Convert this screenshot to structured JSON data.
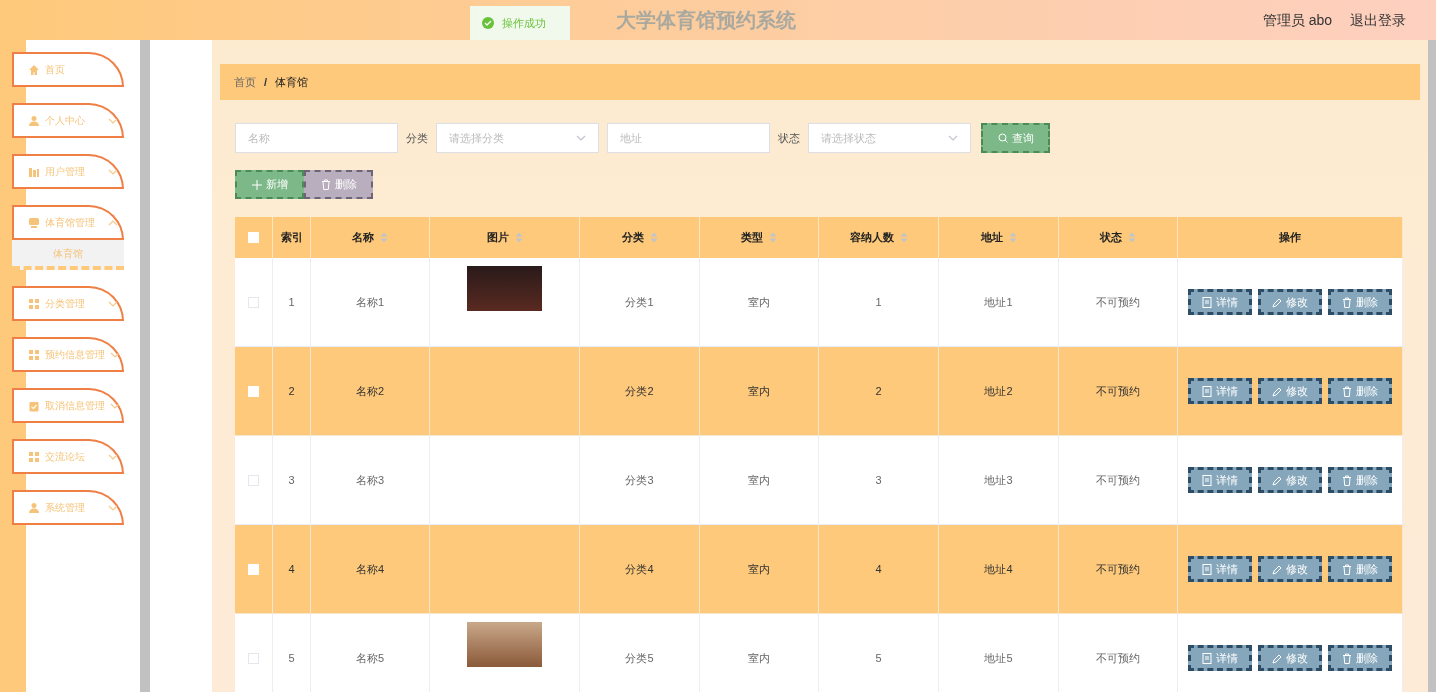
{
  "header": {
    "title": "大学体育馆预约系统",
    "user": "管理员 abo",
    "logout": "退出登录"
  },
  "toast": {
    "text": "操作成功"
  },
  "sidebar": {
    "items": [
      {
        "label": "首页",
        "expandable": false
      },
      {
        "label": "个人中心",
        "expandable": true,
        "expanded": false
      },
      {
        "label": "用户管理",
        "expandable": true,
        "expanded": false
      },
      {
        "label": "体育馆管理",
        "expandable": true,
        "expanded": true,
        "children": [
          {
            "label": "体育馆",
            "selected": true
          }
        ]
      },
      {
        "label": "分类管理",
        "expandable": true,
        "expanded": false
      },
      {
        "label": "预约信息管理",
        "expandable": true,
        "expanded": false
      },
      {
        "label": "取消信息管理",
        "expandable": true,
        "expanded": false
      },
      {
        "label": "交流论坛",
        "expandable": true,
        "expanded": false
      },
      {
        "label": "系统管理",
        "expandable": true,
        "expanded": false
      }
    ]
  },
  "breadcrumb": {
    "items": [
      "首页",
      "体育馆"
    ],
    "separator": "/"
  },
  "filters": {
    "name": {
      "placeholder": "名称"
    },
    "category": {
      "label": "分类",
      "placeholder": "请选择分类"
    },
    "address": {
      "placeholder": "地址"
    },
    "status": {
      "label": "状态",
      "placeholder": "请选择状态"
    },
    "search_button": "查询"
  },
  "actions": {
    "add": "新增",
    "delete": "删除"
  },
  "table": {
    "select_all_checked": false,
    "columns": [
      {
        "kind": "checkbox"
      },
      {
        "label": "索引",
        "kind": "text",
        "sortable": false
      },
      {
        "label": "名称",
        "kind": "text",
        "sortable": true
      },
      {
        "label": "图片",
        "kind": "image",
        "sortable": true
      },
      {
        "label": "分类",
        "kind": "text",
        "sortable": true
      },
      {
        "label": "类型",
        "kind": "text",
        "sortable": true
      },
      {
        "label": "容纳人数",
        "kind": "text",
        "sortable": true
      },
      {
        "label": "地址",
        "kind": "text",
        "sortable": true
      },
      {
        "label": "状态",
        "kind": "text",
        "sortable": true
      },
      {
        "label": "操作",
        "kind": "actions",
        "sortable": false
      }
    ],
    "rows": [
      {
        "checked": false,
        "index": "1",
        "name": "名称1",
        "has_photo": true,
        "category": "分类1",
        "type": "室内",
        "capacity": "1",
        "address": "地址1",
        "status": "不可预约",
        "actions": [
          "详情",
          "修改",
          "删除"
        ]
      },
      {
        "checked": false,
        "index": "2",
        "name": "名称2",
        "has_photo": false,
        "category": "分类2",
        "type": "室内",
        "capacity": "2",
        "address": "地址2",
        "status": "不可预约",
        "actions": [
          "详情",
          "修改",
          "删除"
        ]
      },
      {
        "checked": false,
        "index": "3",
        "name": "名称3",
        "has_photo": false,
        "category": "分类3",
        "type": "室内",
        "capacity": "3",
        "address": "地址3",
        "status": "不可预约",
        "actions": [
          "详情",
          "修改",
          "删除"
        ]
      },
      {
        "checked": false,
        "index": "4",
        "name": "名称4",
        "has_photo": false,
        "category": "分类4",
        "type": "室内",
        "capacity": "4",
        "address": "地址4",
        "status": "不可预约",
        "actions": [
          "详情",
          "修改",
          "删除"
        ]
      },
      {
        "checked": false,
        "index": "5",
        "name": "名称5",
        "has_photo": true,
        "category": "分类5",
        "type": "室内",
        "capacity": "5",
        "address": "地址5",
        "status": "不可预约",
        "actions": [
          "详情",
          "修改",
          "删除"
        ]
      }
    ]
  }
}
